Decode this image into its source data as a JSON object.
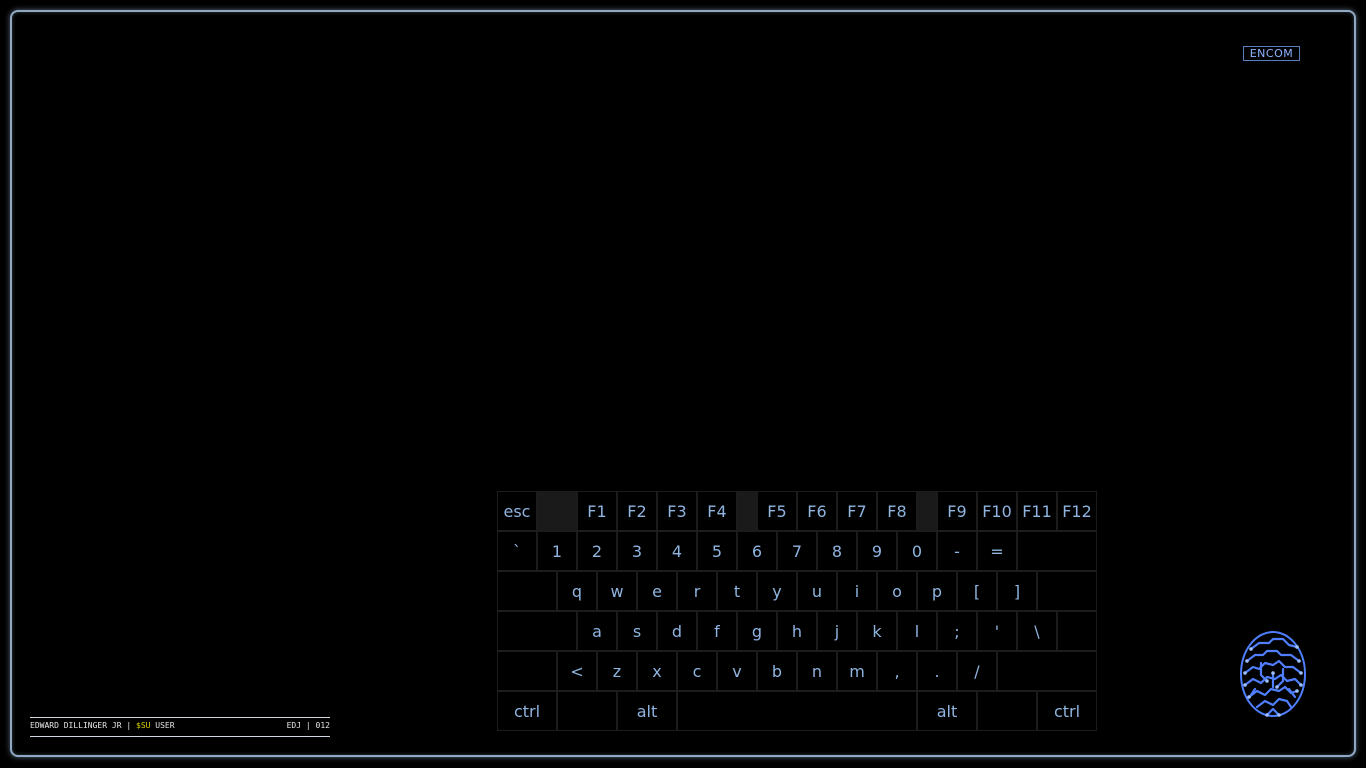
{
  "brand": {
    "logo_text": "ENCOM"
  },
  "status_bar": {
    "user_name": "EDWARD DILLINGER JR",
    "separator": "|",
    "prompt_symbol": "$SU",
    "role": "USER",
    "initials": "EDJ",
    "id_number": "012"
  },
  "keyboard": {
    "rows": [
      [
        "esc",
        "",
        "F1",
        "F2",
        "F3",
        "F4",
        "",
        "F5",
        "F6",
        "F7",
        "F8",
        "",
        "F9",
        "F10",
        "F11",
        "F12"
      ],
      [
        "`",
        "1",
        "2",
        "3",
        "4",
        "5",
        "6",
        "7",
        "8",
        "9",
        "0",
        "-",
        "=",
        ""
      ],
      [
        "",
        "q",
        "w",
        "e",
        "r",
        "t",
        "y",
        "u",
        "i",
        "o",
        "p",
        "[",
        "]",
        ""
      ],
      [
        "",
        "a",
        "s",
        "d",
        "f",
        "g",
        "h",
        "j",
        "k",
        "l",
        ";",
        "'",
        "\\",
        ""
      ],
      [
        "",
        "<",
        "z",
        "x",
        "c",
        "v",
        "b",
        "n",
        "m",
        ",",
        ".",
        "/",
        ""
      ],
      [
        "ctrl",
        "",
        "alt",
        "",
        "alt",
        "",
        "ctrl"
      ]
    ]
  },
  "colors": {
    "frame_border": "#8fa9c4",
    "key_text": "#8fb4e0",
    "accent_yellow": "#d8d200",
    "fingerprint": "#4f7fff"
  },
  "icons": {
    "fingerprint": "fingerprint-icon"
  }
}
